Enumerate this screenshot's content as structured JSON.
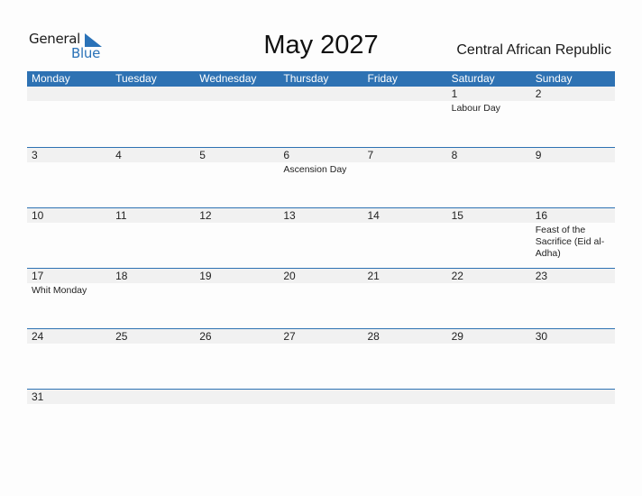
{
  "logo": {
    "text_top": "General",
    "text_bottom": "Blue",
    "icon": "logo-triangle-icon",
    "brand_color": "#2a72b8"
  },
  "title": "May 2027",
  "country": "Central African Republic",
  "colors": {
    "header_bg": "#2e72b3",
    "date_strip_bg": "#f1f1f1",
    "rule": "#2e72b3"
  },
  "weekdays": [
    "Monday",
    "Tuesday",
    "Wednesday",
    "Thursday",
    "Friday",
    "Saturday",
    "Sunday"
  ],
  "weeks": [
    {
      "days": [
        "",
        "",
        "",
        "",
        "",
        "1",
        "2"
      ],
      "events": [
        "",
        "",
        "",
        "",
        "",
        "Labour Day",
        ""
      ]
    },
    {
      "days": [
        "3",
        "4",
        "5",
        "6",
        "7",
        "8",
        "9"
      ],
      "events": [
        "",
        "",
        "",
        "Ascension Day",
        "",
        "",
        ""
      ]
    },
    {
      "days": [
        "10",
        "11",
        "12",
        "13",
        "14",
        "15",
        "16"
      ],
      "events": [
        "",
        "",
        "",
        "",
        "",
        "",
        "Feast of the Sacrifice (Eid al-Adha)"
      ]
    },
    {
      "days": [
        "17",
        "18",
        "19",
        "20",
        "21",
        "22",
        "23"
      ],
      "events": [
        "Whit Monday",
        "",
        "",
        "",
        "",
        "",
        ""
      ]
    },
    {
      "days": [
        "24",
        "25",
        "26",
        "27",
        "28",
        "29",
        "30"
      ],
      "events": [
        "",
        "",
        "",
        "",
        "",
        "",
        ""
      ]
    },
    {
      "days": [
        "31",
        "",
        "",
        "",
        "",
        "",
        ""
      ],
      "events": [
        "",
        "",
        "",
        "",
        "",
        "",
        ""
      ]
    }
  ]
}
